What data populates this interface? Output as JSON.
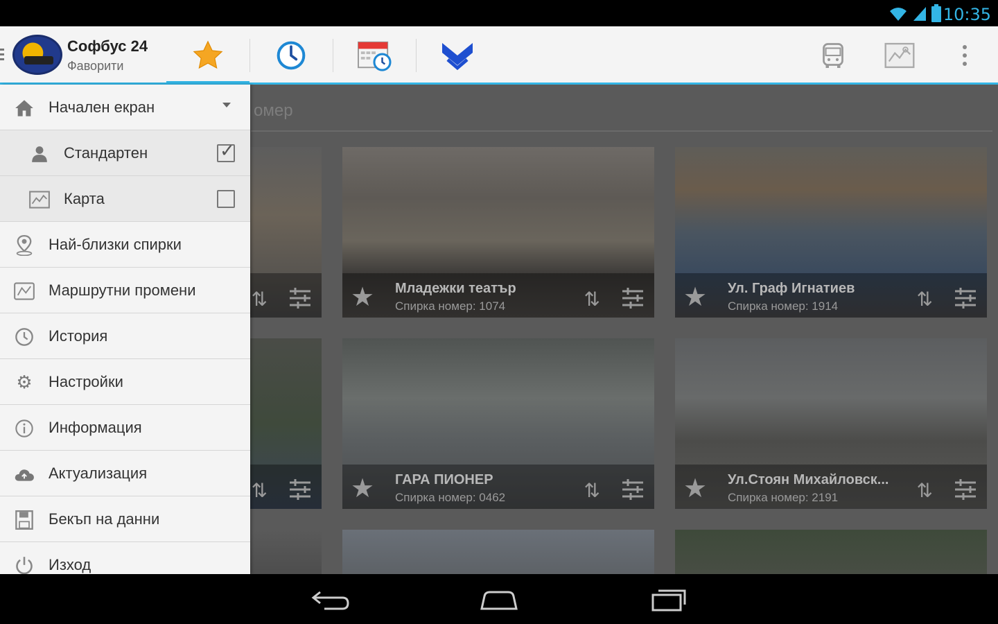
{
  "status_bar": {
    "time": "10:35",
    "icons": [
      "wifi-icon",
      "signal-icon",
      "battery-icon"
    ]
  },
  "action_bar": {
    "title": "Софбус 24",
    "subtitle": "Фаворити",
    "tabs": [
      {
        "id": "favorites",
        "icon": "star-icon",
        "selected": true
      },
      {
        "id": "schedule",
        "icon": "clock-icon",
        "selected": false
      },
      {
        "id": "calendar",
        "icon": "calendar-clock-icon",
        "selected": false
      },
      {
        "id": "metro",
        "icon": "metro-icon",
        "selected": false
      }
    ],
    "actions": [
      "bus-icon",
      "map-icon",
      "overflow-menu-icon"
    ],
    "accent_color": "#33b5e5"
  },
  "search": {
    "visible_text": "омер"
  },
  "drawer": {
    "items": [
      {
        "label": "Начален екран",
        "icon": "home-icon",
        "expanded": true
      },
      {
        "label": "Стандартен",
        "icon": "person-icon",
        "checked": true
      },
      {
        "label": "Карта",
        "icon": "map-icon",
        "checked": false
      },
      {
        "label": "Най-близки спирки",
        "icon": "location-pin-icon"
      },
      {
        "label": "Маршрутни промени",
        "icon": "route-changes-icon"
      },
      {
        "label": "История",
        "icon": "clock-icon"
      },
      {
        "label": "Настройки",
        "icon": "gear-icon"
      },
      {
        "label": "Информация",
        "icon": "info-icon"
      },
      {
        "label": "Актуализация",
        "icon": "cloud-upload-icon"
      },
      {
        "label": "Бекъп на данни",
        "icon": "save-icon"
      },
      {
        "label": "Изход",
        "icon": "power-icon"
      }
    ]
  },
  "cards": [
    {
      "name": "Младежки театър",
      "number": "Спирка номер: 1074"
    },
    {
      "name": "Ул. Граф Игнатиев",
      "number": "Спирка номер: 1914"
    },
    {
      "name": "ГАРА ПИОНЕР",
      "number": "Спирка номер: 0462"
    },
    {
      "name": "Ул.Стоян Михайловск...",
      "number": "Спирка номер: 2191"
    }
  ],
  "nav_bar": [
    "back-icon",
    "home-icon",
    "recents-icon"
  ]
}
